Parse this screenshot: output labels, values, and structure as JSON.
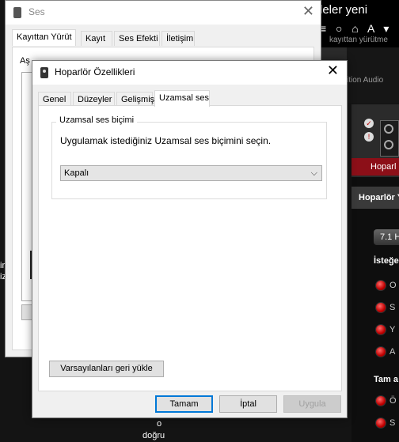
{
  "background_app": {
    "title_fragment": "leler yeni",
    "toolbar_fragment": "≡ ○ ⌂ A ▾",
    "subtitle_fragment": "kayıttan yürütme",
    "realtek_fragment": "ition Audio",
    "hp_tab": "Hoparl",
    "speaker_tab": "Hoparlör Y",
    "select_value": "7.1 H",
    "section1": "İsteğe",
    "radio_letters": [
      "O",
      "S",
      "Y",
      "A"
    ],
    "section2": "Tam a",
    "radio_letters2": [
      "Ö",
      "S"
    ],
    "bottom_line1": "o",
    "bottom_line2": "doğru",
    "left_fragment1": "ir",
    "left_fragment2": "iz",
    "accent": "#8c0f18"
  },
  "ses_window": {
    "title": "Ses",
    "tabs": [
      "Kayıttan Yürüt",
      "Kayıt",
      "Ses Efekti",
      "İletişim"
    ],
    "active_tab": 0,
    "peek_text": "Aş"
  },
  "dialog": {
    "title": "Hoparlör Özellikleri",
    "tabs": [
      "Genel",
      "Düzeyler",
      "Gelişmiş",
      "Uzamsal ses"
    ],
    "active_tab": 3,
    "group_label": "Uzamsal ses biçimi",
    "instruction": "Uygulamak istediğiniz Uzamsal ses biçimini seçin.",
    "format_select_value": "Kapalı",
    "reset_button": "Varsayılanları geri yükle",
    "ok_button": "Tamam",
    "cancel_button": "İptal",
    "apply_button": "Uygula",
    "focus_color": "#0078d7"
  }
}
